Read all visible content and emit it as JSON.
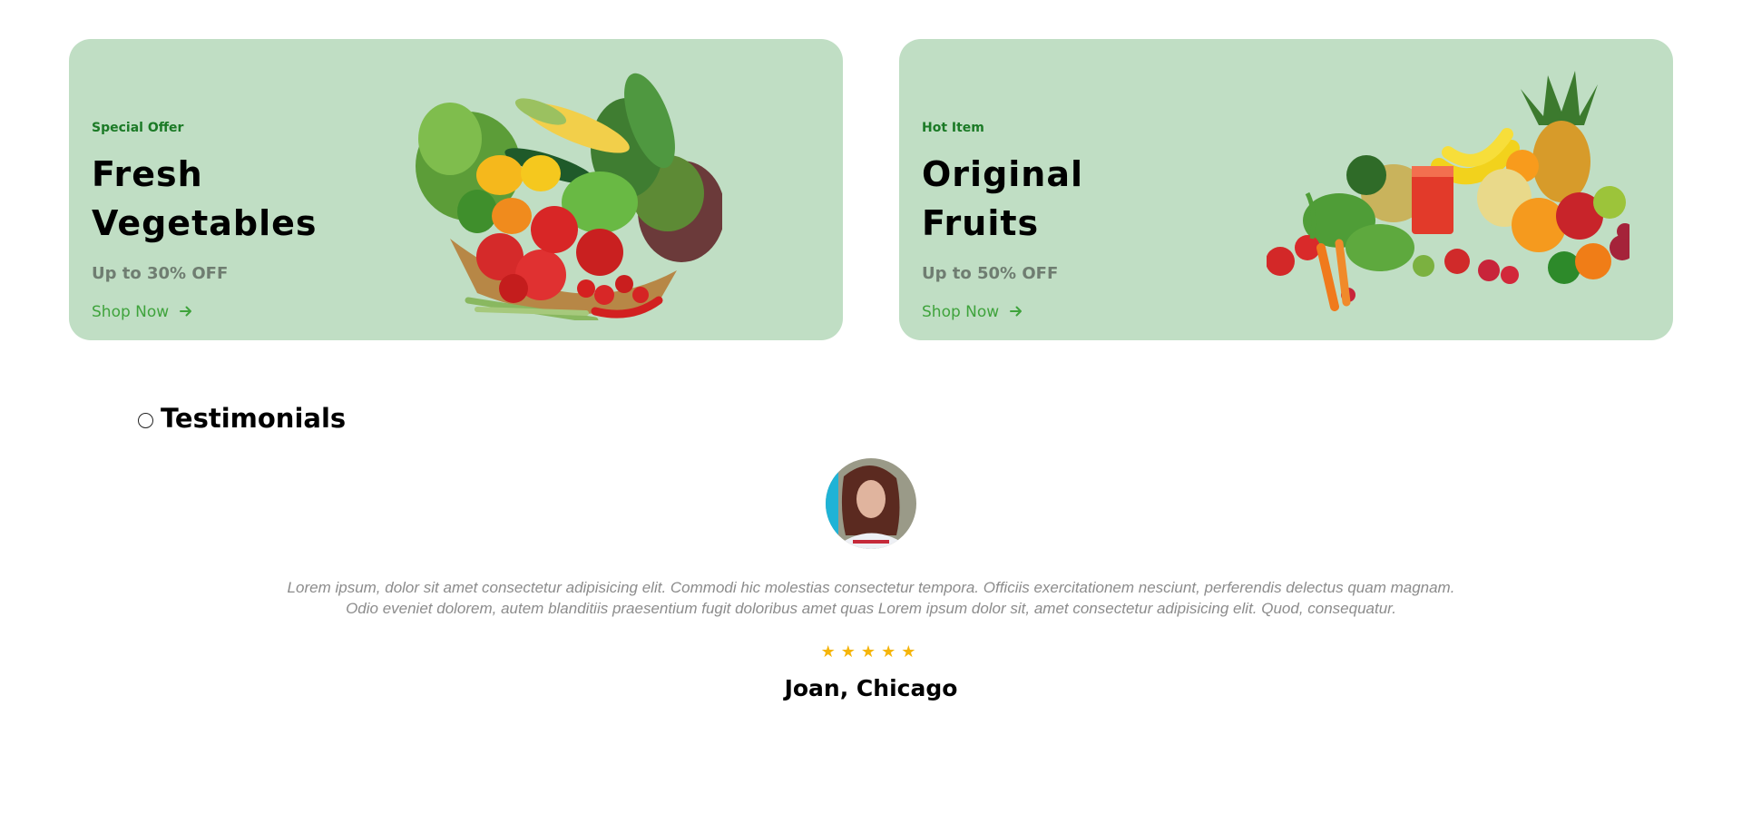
{
  "colors": {
    "banner_bg": "#c0dec4",
    "eyebrow": "#1b7a26",
    "shop_link": "#3fa33c",
    "star": "#f5b50a",
    "quote_text": "#8c8c8c"
  },
  "banners": [
    {
      "eyebrow": "Special Offer",
      "title_line1": "Fresh",
      "title_line2": "Vegetables",
      "subtitle": "Up to 30% OFF",
      "cta": "Shop Now",
      "cta_icon": "arrow-right-icon",
      "image": "vegetable-basket"
    },
    {
      "eyebrow": "Hot Item",
      "title_line1": "Original",
      "title_line2": "Fruits",
      "subtitle": "Up to 50% OFF",
      "cta": "Shop Now",
      "cta_icon": "arrow-right-icon",
      "image": "fruit-assortment"
    }
  ],
  "testimonials": {
    "heading": "Testimonials",
    "quote_line1": "Lorem ipsum, dolor sit amet consectetur adipisicing elit. Commodi hic molestias consectetur tempora. Officiis exercitationem nesciunt, perferendis delectus quam magnam.",
    "quote_line2": "Odio eveniet dolorem, autem blanditiis praesentium fugit doloribus amet quas Lorem ipsum dolor sit, amet consectetur adipisicing elit. Quod, consequatur.",
    "rating": 5,
    "rating_max": 5,
    "author": "Joan, Chicago"
  }
}
